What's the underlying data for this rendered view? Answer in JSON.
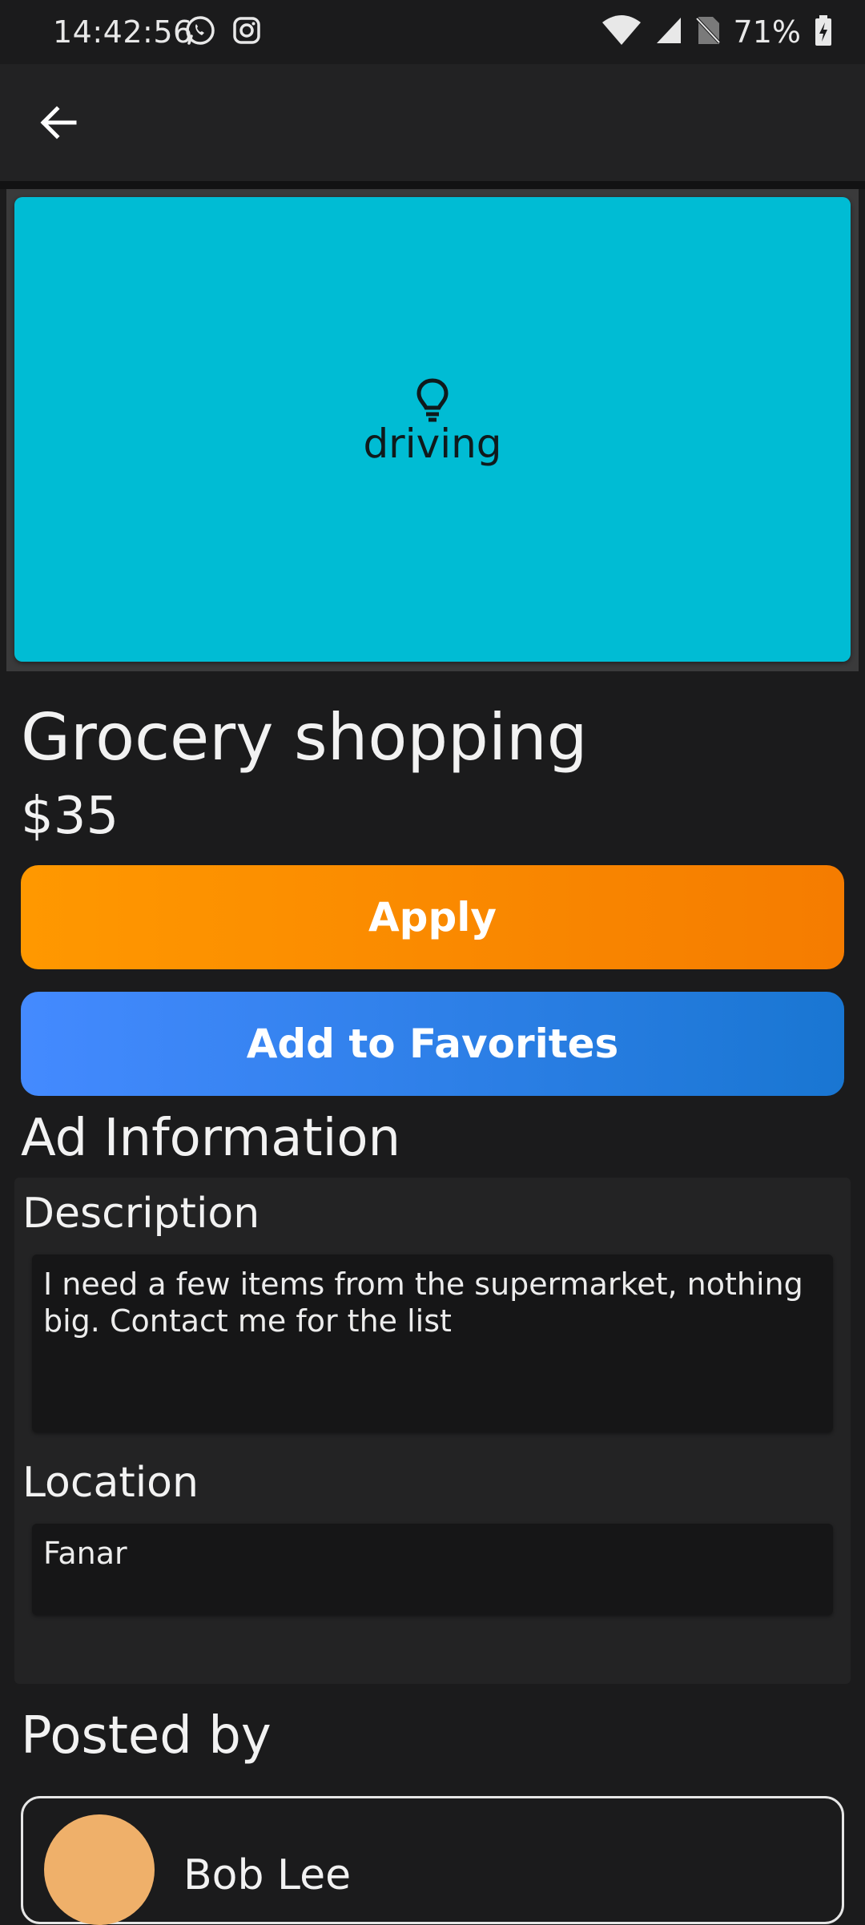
{
  "status_bar": {
    "time": "14:42:56",
    "battery": "71%",
    "icons": [
      "whatsapp-icon",
      "instagram-icon",
      "wifi-icon",
      "signal-icon",
      "no-sim-icon",
      "battery-charging-icon"
    ]
  },
  "app_bar": {
    "back_icon": "arrow-back-icon"
  },
  "ad": {
    "image": {
      "background": "#00bcd4",
      "icon": "lightbulb-icon",
      "category": "driving"
    },
    "title": "Grocery shopping",
    "price": "$35"
  },
  "actions": {
    "apply_label": "Apply",
    "favorites_label": "Add to Favorites",
    "apply_colors": [
      "#ff9800",
      "#f57c00"
    ],
    "favorites_colors": [
      "#448aff",
      "#1976d2"
    ]
  },
  "ad_information": {
    "heading": "Ad Information",
    "description_label": "Description",
    "description_value": "I need a few items from the supermarket, nothing big. Contact me for the list",
    "location_label": "Location",
    "location_value": "Fanar"
  },
  "posted_by": {
    "heading": "Posted by",
    "name": "Bob Lee",
    "avatar_color": "#efb06a"
  }
}
